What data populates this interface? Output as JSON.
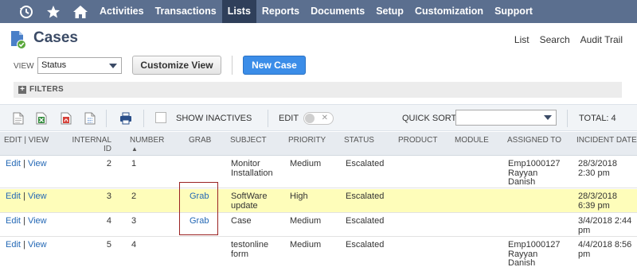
{
  "nav": {
    "icons": [
      "history-icon",
      "star-icon",
      "home-icon"
    ],
    "items": [
      "Activities",
      "Transactions",
      "Lists",
      "Reports",
      "Documents",
      "Setup",
      "Customization",
      "Support"
    ],
    "active": "Lists"
  },
  "header": {
    "title": "Cases",
    "links": [
      "List",
      "Search",
      "Audit Trail"
    ]
  },
  "view": {
    "label": "VIEW",
    "selected": "Status",
    "customize_label": "Customize View",
    "new_case_label": "New Case"
  },
  "filters": {
    "label": "FILTERS"
  },
  "toolbar": {
    "icons": [
      "new-document-icon",
      "export-excel-icon",
      "export-pdf-icon",
      "export-csv-icon",
      "print-icon"
    ],
    "show_inactives": "SHOW INACTIVES",
    "edit": "EDIT",
    "quick_sort": "QUICK SORT",
    "quick_sort_value": "",
    "total": "TOTAL: 4"
  },
  "table": {
    "headers": {
      "edit_view": "EDIT | VIEW",
      "internal_id": "INTERNAL ID",
      "number": "NUMBER",
      "grab": "GRAB",
      "subject": "SUBJECT",
      "priority": "PRIORITY",
      "status": "STATUS",
      "product": "PRODUCT",
      "module": "MODULE",
      "assigned_to": "ASSIGNED TO",
      "incident_date": "INCIDENT DATE"
    },
    "sort_indicator": "▲",
    "edit_label": "Edit",
    "view_label": "View",
    "sep": "|",
    "rows": [
      {
        "internal_id": "2",
        "number": "1",
        "grab": "",
        "subject": "Monitor Installation",
        "priority": "Medium",
        "status": "Escalated",
        "product": "",
        "module": "",
        "assigned_to": "Emp1000127 Rayyan Danish",
        "incident_date": "28/3/2018 2:30 pm",
        "highlight": false
      },
      {
        "internal_id": "3",
        "number": "2",
        "grab": "Grab",
        "subject": "SoftWare update",
        "priority": "High",
        "status": "Escalated",
        "product": "",
        "module": "",
        "assigned_to": "",
        "incident_date": "28/3/2018 6:39 pm",
        "highlight": true
      },
      {
        "internal_id": "4",
        "number": "3",
        "grab": "Grab",
        "subject": "Case",
        "priority": "Medium",
        "status": "Escalated",
        "product": "",
        "module": "",
        "assigned_to": "",
        "incident_date": "3/4/2018 2:44 pm",
        "highlight": false
      },
      {
        "internal_id": "5",
        "number": "4",
        "grab": "",
        "subject": "testonline form",
        "priority": "Medium",
        "status": "Escalated",
        "product": "",
        "module": "",
        "assigned_to": "Emp1000127 Rayyan Danish",
        "incident_date": "4/4/2018 8:56 pm",
        "highlight": false
      }
    ]
  },
  "colors": {
    "nav_bg": "#5b6f8f",
    "nav_active": "#2f3f5a",
    "primary_button": "#3b8de8",
    "link": "#2468b5",
    "row_highlight": "#fefdba",
    "grab_outline": "#9a2222"
  }
}
